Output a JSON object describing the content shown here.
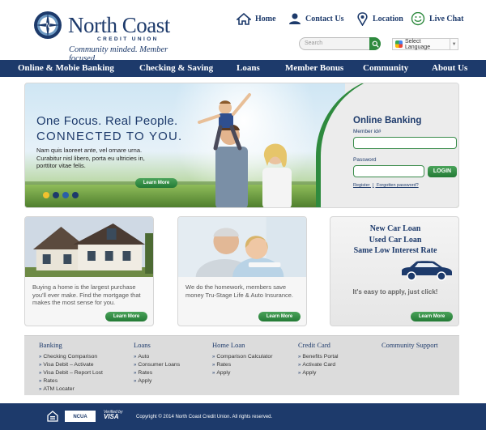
{
  "header": {
    "brand": "North Coast",
    "sub": "CREDIT UNION",
    "tagline": "Community minded. Member focused.",
    "toplinks": [
      {
        "label": "Home",
        "icon": "house-icon"
      },
      {
        "label": "Contact Us",
        "icon": "people-icon"
      },
      {
        "label": "Location",
        "icon": "map-pin-icon"
      },
      {
        "label": "Live Chat",
        "icon": "chat-icon"
      }
    ],
    "search_placeholder": "Search",
    "language_label": "Select Language"
  },
  "nav": [
    "Online & Mobie Banking",
    "Checking & Saving",
    "Loans",
    "Member Bonus",
    "Community",
    "About Us"
  ],
  "hero": {
    "line1": "One Focus. Real People.",
    "line2": "CONNECTED TO YOU.",
    "body": "Nam quis laoreet ante, vel ornare urna. Curabitur nisl libero, porta eu ultricies in, porttitor vitae felis.",
    "learn_more": "Learn More",
    "dot_colors": [
      "#f2c12e",
      "#1d3a6b",
      "#2a5fa8",
      "#1d3a6b"
    ]
  },
  "login": {
    "title": "Online Banking",
    "member_label": "Member id#",
    "password_label": "Password",
    "button": "LOGIN",
    "register": "Register",
    "separator": "|",
    "forgot": "Forgotten password?"
  },
  "cards": [
    {
      "text": "Buying a home is the largest purchase you'll ever make. Find the mortgage that makes the most sense for you.",
      "button": "Learn More"
    },
    {
      "text": "We do the homework, members save money Tru-Stage Life & Auto Insurance.",
      "button": "Learn More"
    }
  ],
  "promo": {
    "lines": [
      "New Car Loan",
      "Used Car Loan",
      "Same Low Interest Rate"
    ],
    "easy": "It's easy to apply, just click!",
    "button": "Learn More"
  },
  "footer_links": [
    {
      "head": "Banking",
      "items": [
        "Checking Comparison",
        "Visa Debit – Activate",
        "Visa Debit – Report Lost",
        "Rates",
        "ATM Locater"
      ]
    },
    {
      "head": "Loans",
      "items": [
        "Auto",
        "Consumer Loans",
        "Rates",
        "Apply"
      ]
    },
    {
      "head": "Home Loan",
      "items": [
        "Comparison Calculator",
        "Rates",
        "Apply"
      ]
    },
    {
      "head": "Credit Card",
      "items": [
        "Benefits Portal",
        "Activate Card",
        "Apply"
      ]
    },
    {
      "head": "Community Support",
      "items": []
    }
  ],
  "bottom": {
    "ncua": "NCUA",
    "visa_line1": "Verified by",
    "visa_line2": "VISA",
    "copyright": "Copyright © 2014  North Coast Credit Union. All rights reserved."
  },
  "colors": {
    "navy": "#1d3a6b",
    "green": "#2e8a3e"
  }
}
